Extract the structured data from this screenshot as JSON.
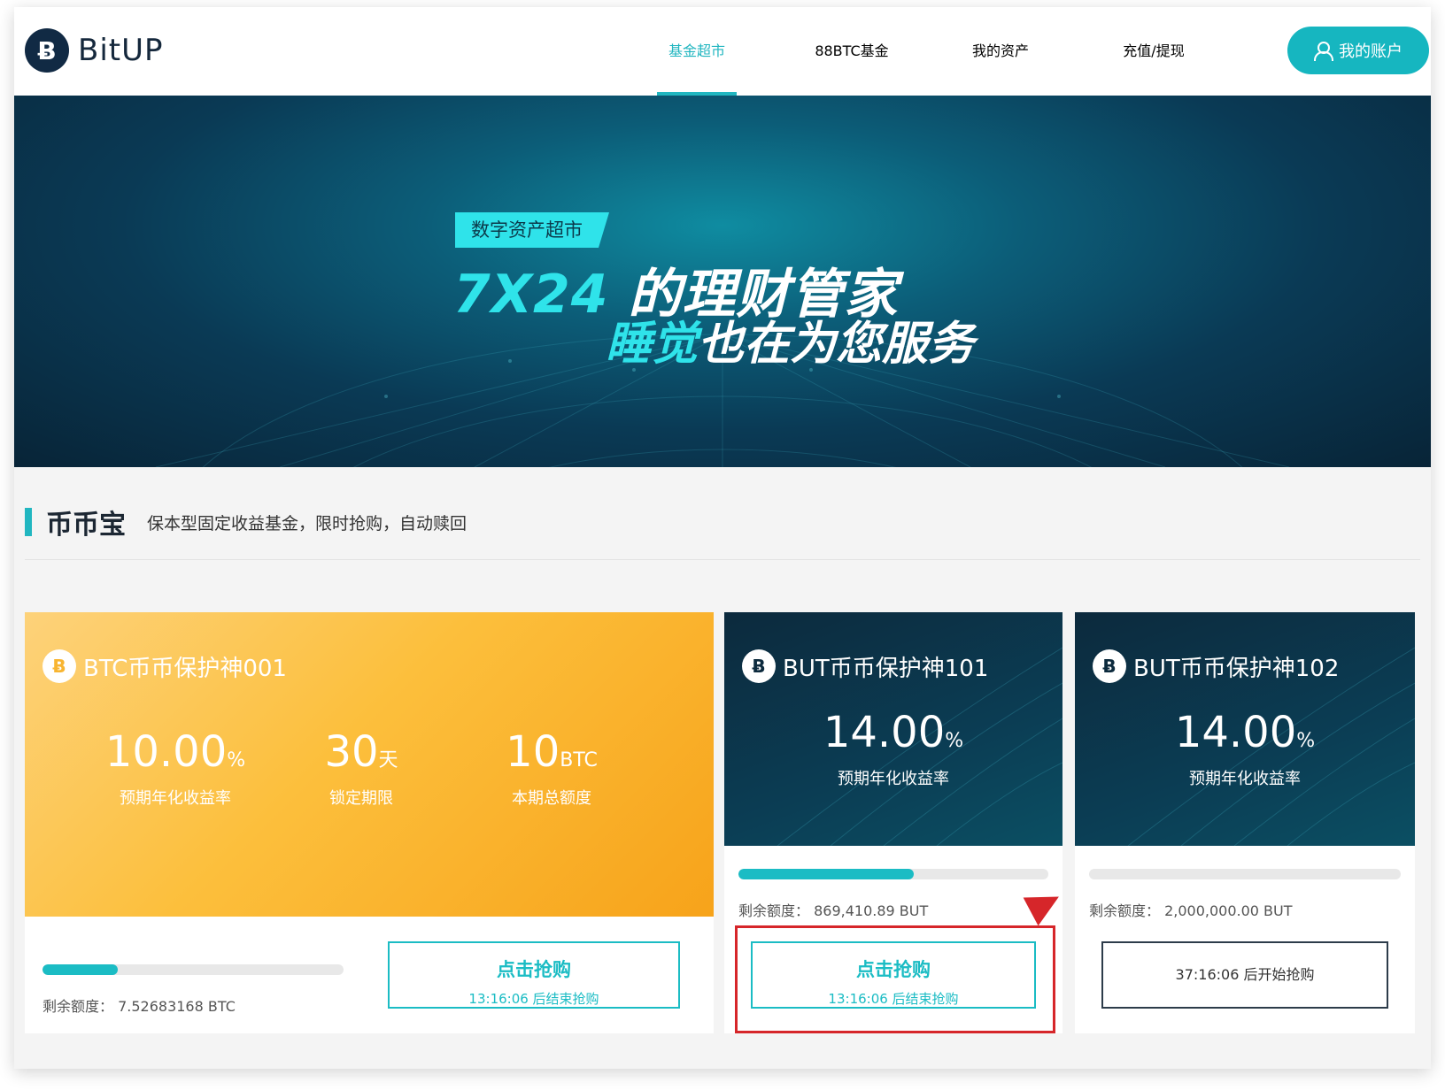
{
  "header": {
    "logo_glyph": "Ƀ",
    "logo_text": "BitUP",
    "nav": [
      "基金超市",
      "88BTC基金",
      "我的资产",
      "充值/提现"
    ],
    "account_label": "我的账户"
  },
  "banner": {
    "tag": "数字资产超市",
    "line1_highlight": "7X24",
    "line1_rest": "的理财管家",
    "line2_highlight": "睡觉",
    "line2_rest": "也在为您服务"
  },
  "section": {
    "title": "币币宝",
    "subtitle": "保本型固定收益基金，限时抢购，自动赎回"
  },
  "cards": [
    {
      "title": "BTC币币保护神001",
      "coin": "Ƀ",
      "stats": [
        {
          "value": "10.00",
          "unit": "%",
          "label": "预期年化收益率"
        },
        {
          "value": "30",
          "unit": "天",
          "label": "锁定期限"
        },
        {
          "value": "10",
          "unit": "BTC",
          "label": "本期总额度"
        }
      ],
      "progress": 0.25,
      "remaining": "剩余额度：  7.52683168 BTC",
      "button_main": "点击抢购",
      "button_sub": "13:16:06 后结束抢购"
    },
    {
      "title": "BUT币币保护神101",
      "coin": "Ƀ",
      "rate": "14.00",
      "rate_unit": "%",
      "rate_label": "预期年化收益率",
      "progress": 0.565,
      "remaining": "剩余额度：  869,410.89 BUT",
      "button_main": "点击抢购",
      "button_sub": "13:16:06 后结束抢购"
    },
    {
      "title": "BUT币币保护神102",
      "coin": "Ƀ",
      "rate": "14.00",
      "rate_unit": "%",
      "rate_label": "预期年化收益率",
      "progress": 0,
      "remaining": "剩余额度：  2,000,000.00 BUT",
      "button_wait": "37:16:06 后开始抢购"
    }
  ],
  "colors": {
    "accent": "#1bbcc4",
    "annotation": "#d6262a",
    "banner_highlight": "#2fe3ea"
  }
}
